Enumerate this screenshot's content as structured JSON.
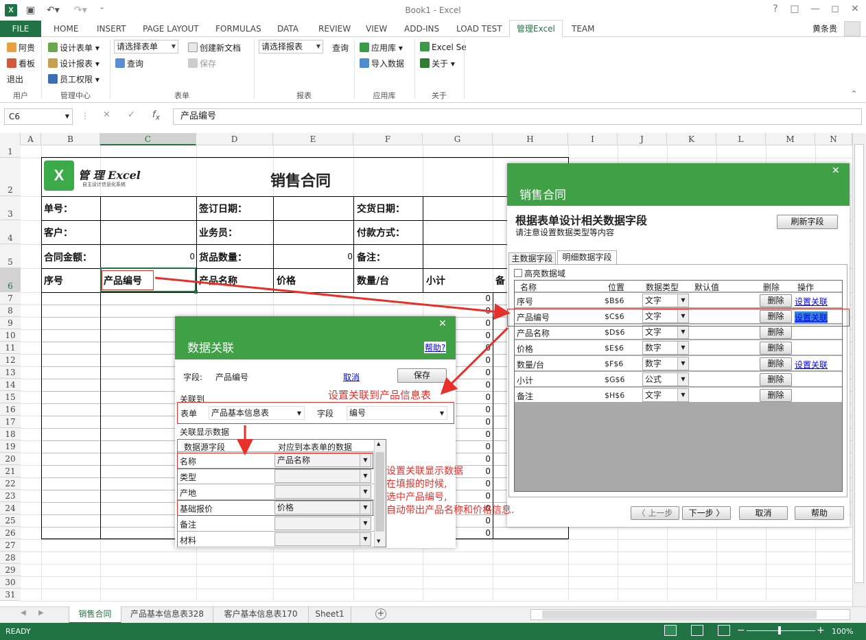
{
  "app": {
    "logo": "X",
    "title": "Book1 - Excel",
    "user": "黄条贵"
  },
  "window": {
    "help": "?",
    "restore": "□",
    "minimize": "—",
    "maximize": "◻",
    "close": "✕"
  },
  "tabs": [
    "HOME",
    "INSERT",
    "PAGE LAYOUT",
    "FORMULAS",
    "DATA",
    "REVIEW",
    "VIEW",
    "ADD-INS",
    "LOAD TEST",
    "管理Excel",
    "TEAM"
  ],
  "file_tab": "FILE",
  "ribbon": {
    "user_items": [
      "阿贵",
      "看板",
      "退出"
    ],
    "mgmt_items": [
      "设计表单",
      "设计报表",
      "员工权限"
    ],
    "form_select": "请选择表单",
    "form_query": "查询",
    "form_new": "创建新文档",
    "form_save": "保存",
    "report_select": "请选择报表",
    "report_query": "查询",
    "app_items": [
      "应用库",
      "导入数据"
    ],
    "about_items": [
      "Excel Se",
      "关于"
    ],
    "groups": [
      "用户",
      "管理中心",
      "表单",
      "报表",
      "应用库",
      "关于"
    ]
  },
  "formula_bar": {
    "name_box": "C6",
    "formula": "产品编号"
  },
  "columns": [
    "A",
    "B",
    "C",
    "D",
    "E",
    "F",
    "G",
    "H",
    "I",
    "J",
    "K",
    "L",
    "M",
    "N"
  ],
  "rows": [
    "1",
    "2",
    "3",
    "4",
    "5",
    "6",
    "7",
    "8",
    "9",
    "10",
    "11",
    "12",
    "13",
    "14",
    "15",
    "16",
    "17",
    "18",
    "19",
    "20",
    "21",
    "22",
    "23",
    "24",
    "25",
    "26",
    "27",
    "28",
    "29",
    "30",
    "31"
  ],
  "sheet": {
    "logo_title": "管 理 Excel",
    "logo_sub": "自主设计信息化系统",
    "logo_x": "X",
    "title": "销售合同",
    "labels": {
      "order_no": "单号：",
      "sign_date": "签订日期：",
      "delivery_date": "交货日期：",
      "customer": "客户：",
      "salesman": "业务员：",
      "payment": "付款方式：",
      "amount": "合同金额：",
      "amount_val": "0",
      "qty": "货品数量：",
      "qty_val": "0",
      "remark": "备注："
    },
    "headers": [
      "序号",
      "产品编号",
      "产品名称",
      "价格",
      "数量/台",
      "小计",
      "备"
    ],
    "zero": "0"
  },
  "dlg_sales": {
    "title": "销售合同",
    "heading": "根据表单设计相关数据字段",
    "sub": "请注意设置数据类型等内容",
    "refresh": "刷新字段",
    "tab_main": "主数据字段",
    "tab_detail": "明细数据字段",
    "highlight": "高亮数据域",
    "cols": [
      "名称",
      "位置",
      "数据类型",
      "默认值",
      "删除",
      "操作"
    ],
    "rows": [
      {
        "name": "序号",
        "pos": "$B$6",
        "type": "文字",
        "del": "删除",
        "op": "设置关联"
      },
      {
        "name": "产品编号",
        "pos": "$C$6",
        "type": "文字",
        "del": "删除",
        "op": "设置关联"
      },
      {
        "name": "产品名称",
        "pos": "$D$6",
        "type": "文字",
        "del": "删除",
        "op": ""
      },
      {
        "name": "价格",
        "pos": "$E$6",
        "type": "数字",
        "del": "删除",
        "op": ""
      },
      {
        "name": "数量/台",
        "pos": "$F$6",
        "type": "数字",
        "del": "删除",
        "op": "设置关联"
      },
      {
        "name": "小计",
        "pos": "$G$6",
        "type": "公式",
        "del": "删除",
        "op": ""
      },
      {
        "name": "备注",
        "pos": "$H$6",
        "type": "文字",
        "del": "删除",
        "op": ""
      }
    ],
    "prev": "〈 上一步",
    "next": "下一步 〉",
    "cancel": "取消",
    "help": "帮助"
  },
  "dlg_link": {
    "title": "数据关联",
    "help": "帮助?",
    "field_label": "字段:",
    "field_value": "产品编号",
    "cancel": "取消",
    "save": "保存",
    "link_to": "关联到",
    "table_label": "表单",
    "table_value": "产品基本信息表",
    "field2_label": "字段",
    "field2_value": "编号",
    "display_label": "关联显示数据",
    "col_src": "数据源字段",
    "col_dst": "对应到本表单的数据",
    "rows": [
      {
        "src": "名称",
        "dst": "产品名称"
      },
      {
        "src": "类型",
        "dst": ""
      },
      {
        "src": "产地",
        "dst": ""
      },
      {
        "src": "基础报价",
        "dst": "价格"
      },
      {
        "src": "备注",
        "dst": ""
      },
      {
        "src": "材料",
        "dst": ""
      }
    ]
  },
  "annotations": {
    "a1": "设置关联到产品信息表",
    "a2": [
      "设置关联显示数据",
      "在填报的时候,",
      "选中产品编号,",
      "自动带出产品名称和价格信息."
    ]
  },
  "sheet_tabs": [
    "销售合同",
    "产品基本信息表328",
    "客户基本信息表170",
    "Sheet1"
  ],
  "status": {
    "ready": "READY",
    "zoom": "100%"
  },
  "colors": {
    "excel_green": "#217346",
    "dialog_green": "#3fa046",
    "annotation_red": "#e8302a"
  }
}
